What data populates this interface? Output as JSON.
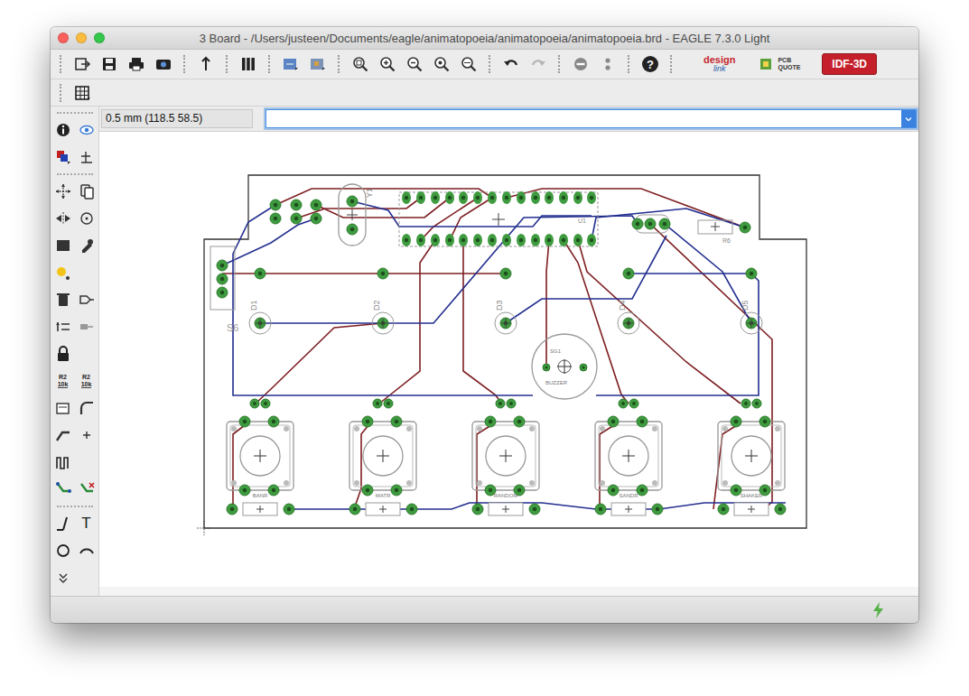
{
  "window": {
    "title": "3 Board - /Users/justeen/Documents/eagle/animatopoeia/animatopoeia/animatopoeia.brd - EAGLE 7.3.0 Light"
  },
  "toolbar": {
    "help_icon": "?",
    "design_link": {
      "top": "design",
      "bottom": "link"
    },
    "pcb_quote": {
      "top": "PCB",
      "bottom": "QUOTE"
    },
    "idf_button": "IDF-3D"
  },
  "side_tools": {
    "name_tool": {
      "top": "R2",
      "bottom": "10k"
    },
    "value_tool": {
      "top": "R2",
      "bottom": "10k"
    },
    "text_tool": "T"
  },
  "command_bar": {
    "coordinate": "0.5 mm (118.5 58.5)",
    "command": "",
    "focused": true
  },
  "board": {
    "crystal": "Y1",
    "chip": "U1",
    "resistor": "R6",
    "switch": "S6",
    "leds": [
      {
        "name": "D1"
      },
      {
        "name": "D2"
      },
      {
        "name": "D3"
      },
      {
        "name": "D4"
      },
      {
        "name": "D5"
      }
    ],
    "buzzer": {
      "name": "SG1",
      "value": "BUZZER"
    },
    "buttons": [
      {
        "label": "BANR"
      },
      {
        "label": "MATR"
      },
      {
        "label": "RANDOM"
      },
      {
        "label": "SANDR"
      },
      {
        "label": "SHAKER"
      }
    ]
  }
}
